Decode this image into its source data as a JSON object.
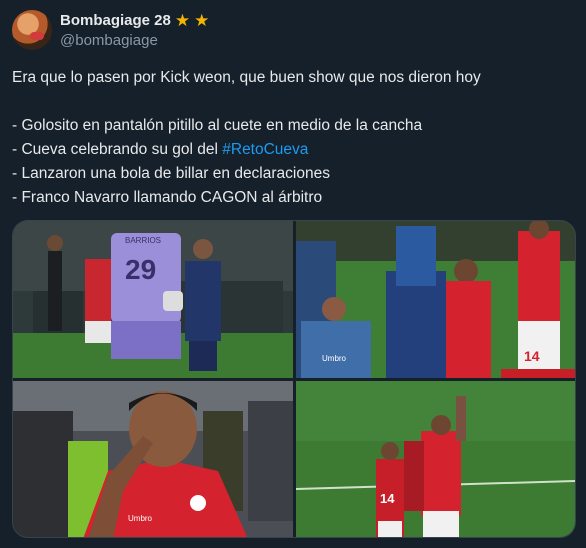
{
  "author": {
    "display_name": "Bombagiage 28",
    "handle": "@bombagiage",
    "badges": [
      "star-icon",
      "star-icon"
    ],
    "badge_color": "#f4b400"
  },
  "tweet": {
    "line1": "Era que lo pasen por Kick weon, que buen show que nos dieron hoy",
    "line2": "- Golosito en pantalón pitillo al cuete en medio de la cancha",
    "line3_prefix": "- Cueva celebrando su gol del ",
    "line3_hashtag": "#RetoCueva",
    "line4": "- Lanzaron una bola de billar en declaraciones",
    "line5": "- Franco Navarro llamando CAGON al árbitro"
  },
  "media": {
    "tile1": {
      "shirt_number": "29",
      "name_on_shirt": "BARRIOS"
    },
    "tile2": {
      "shirt_number": "14",
      "sponsor": "Umbro"
    },
    "tile3": {
      "sponsor": "Umbro"
    },
    "tile4": {
      "shirt_number": "14"
    }
  },
  "colors": {
    "background": "#15202b",
    "text": "#e7e9ea",
    "muted": "#8b98a5",
    "link": "#1d9bf0",
    "red_kit": "#d4232e",
    "pitch": "#3d7a32"
  }
}
